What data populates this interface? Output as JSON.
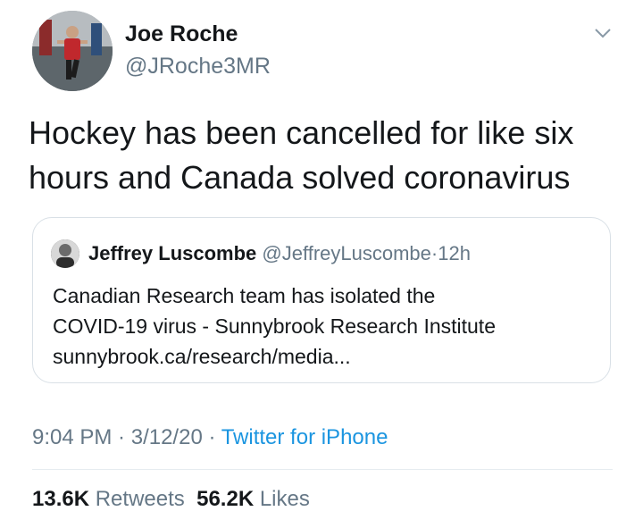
{
  "author": {
    "name": "Joe Roche",
    "handle": "@JRoche3MR",
    "avatar_icon": "runner-photo-avatar"
  },
  "tweet": {
    "text_lines": [
      "Hockey has been cancelled for like six",
      "hours and Canada solved coronavirus"
    ]
  },
  "quote": {
    "name": "Jeffrey Luscombe",
    "handle": "@JeffreyLuscombe",
    "separator": "·",
    "time": "12h",
    "body_lines": [
      "Canadian Research team has isolated the",
      "COVID-19 virus - Sunnybrook Research Institute",
      "sunnybrook.ca/research/media..."
    ]
  },
  "meta": {
    "time": "9:04 PM",
    "sep1": " · ",
    "date": "3/12/20",
    "sep2": " · ",
    "source": "Twitter for iPhone"
  },
  "stats": {
    "retweets_count": "13.6K",
    "retweets_label": "Retweets",
    "likes_count": "56.2K",
    "likes_label": "Likes"
  },
  "colors": {
    "text": "#14171a",
    "secondary": "#657786",
    "link": "#1b95e0",
    "border": "#d9e0e6"
  }
}
